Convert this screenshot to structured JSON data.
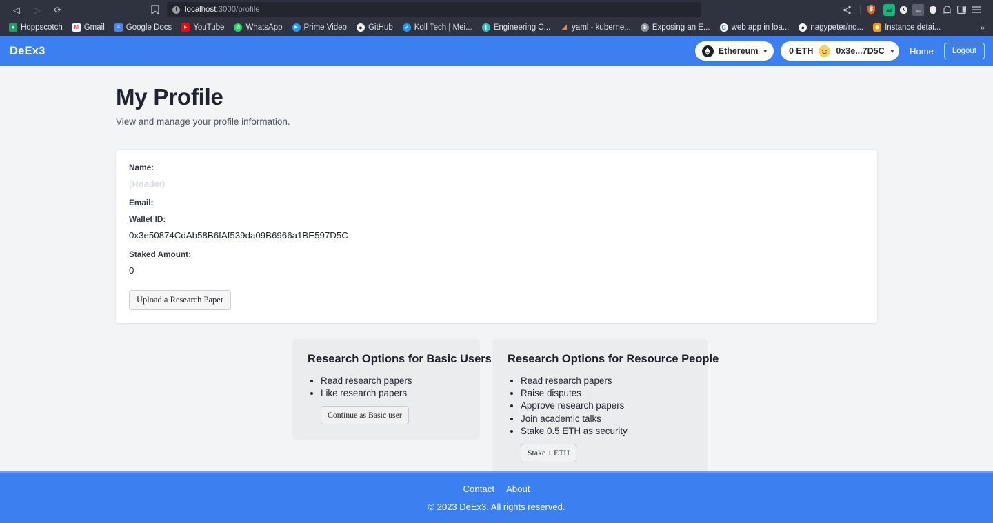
{
  "browser": {
    "nav": {
      "back": "◁",
      "forward": "▷",
      "reload": "⟳"
    },
    "url": {
      "host": "localhost",
      "path": ":3000/profile"
    },
    "bookmarks": [
      {
        "label": "Hoppscotch",
        "icon": "hoppscotch-icon",
        "glyph": "●",
        "color": "#1b9f6a"
      },
      {
        "label": "Gmail",
        "icon": "gmail-icon",
        "glyph": "M",
        "color": "#ffffff",
        "fg": "#ea4335"
      },
      {
        "label": "Google Docs",
        "icon": "google-docs-icon",
        "glyph": "≡",
        "color": "#4285f4"
      },
      {
        "label": "YouTube",
        "icon": "youtube-icon",
        "glyph": "▶",
        "color": "#ff0000"
      },
      {
        "label": "WhatsApp",
        "icon": "whatsapp-icon",
        "glyph": "✆",
        "color": "#25d366"
      },
      {
        "label": "Prime Video",
        "icon": "prime-video-icon",
        "glyph": "▶",
        "color": "#1a98ff"
      },
      {
        "label": "GitHub",
        "icon": "github-icon",
        "glyph": "●",
        "color": "#ffffff",
        "fg": "#24292f"
      },
      {
        "label": "Koll Tech | Mei...",
        "icon": "twitter-verified-icon",
        "glyph": "✔",
        "color": "#1d9bf0"
      },
      {
        "label": "Engineering C...",
        "icon": "engineering-icon",
        "glyph": "❙",
        "color": "#29c3c9"
      },
      {
        "label": "yaml - kuberne...",
        "icon": "stackoverflow-icon",
        "glyph": "◢",
        "color": "#f48024"
      },
      {
        "label": "Exposing an E...",
        "icon": "globe-icon",
        "glyph": "⊕",
        "color": "#8a8f99"
      },
      {
        "label": "web app in loa...",
        "icon": "google-icon",
        "glyph": "G",
        "color": "#ffffff",
        "fg": "#4285f4"
      },
      {
        "label": "nagypeter/no...",
        "icon": "github-icon",
        "glyph": "●",
        "color": "#ffffff",
        "fg": "#24292f"
      },
      {
        "label": "Instance detai...",
        "icon": "aws-icon",
        "glyph": "⬣",
        "color": "#ff9900"
      }
    ],
    "bookmarks_overflow": "»",
    "extensions": [
      {
        "name": "extension-green-icon",
        "glyph": ""
      },
      {
        "name": "clock-icon",
        "glyph": "◔"
      },
      {
        "name": "image-icon",
        "glyph": ""
      },
      {
        "name": "shield-icon",
        "glyph": "⛉"
      },
      {
        "name": "ghost-icon",
        "glyph": "○"
      },
      {
        "name": "sidebar-icon",
        "glyph": "▣"
      },
      {
        "name": "menu-icon",
        "glyph": "≡"
      }
    ]
  },
  "header": {
    "brand": "DeEx3",
    "network": {
      "label": "Ethereum",
      "chevron": "▾",
      "icon_glyph": "♦"
    },
    "wallet": {
      "balance": "0 ETH",
      "address_short": "0x3e...7D5C",
      "chevron": "▾",
      "avatar_glyph": "🧑"
    },
    "home_label": "Home",
    "logout_label": "Logout",
    "accent_color": "#3b7ff0"
  },
  "page": {
    "title": "My Profile",
    "subtitle": "View and manage your profile information."
  },
  "profile": {
    "fields": [
      {
        "label": "Name:",
        "value": "(Reader)",
        "muted": true
      },
      {
        "label": "Email:",
        "value": "",
        "muted": false
      },
      {
        "label": "Wallet ID:",
        "value": "0x3e50874CdAb58B6fAf539da09B6966a1BE597D5C",
        "muted": false
      },
      {
        "label": "Staked Amount:",
        "value": "0",
        "muted": false
      }
    ],
    "upload_button": "Upload a Research Paper"
  },
  "options": {
    "basic": {
      "title": "Research Options for Basic Users",
      "items": [
        "Read research papers",
        "Like research papers"
      ],
      "button": "Continue as Basic user"
    },
    "resource": {
      "title": "Research Options for Resource People",
      "items": [
        "Read research papers",
        "Raise disputes",
        "Approve research papers",
        "Join academic talks",
        "Stake 0.5 ETH as security"
      ],
      "button": "Stake 1 ETH"
    }
  },
  "footer": {
    "links": [
      "Contact",
      "About"
    ],
    "copyright": "© 2023 DeEx3. All rights reserved."
  }
}
